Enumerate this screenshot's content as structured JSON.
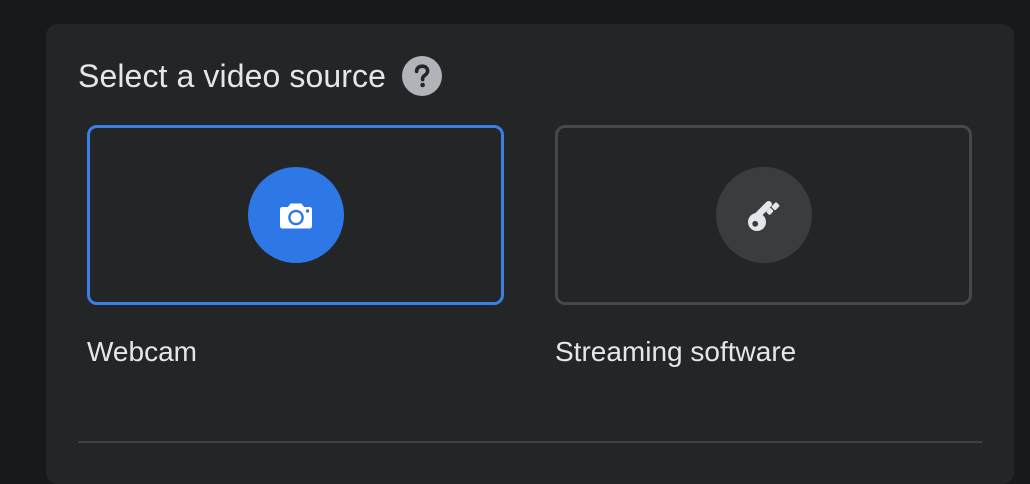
{
  "panel": {
    "title": "Select a video source",
    "help_icon": "question-mark-icon"
  },
  "options": [
    {
      "label": "Webcam",
      "icon": "camera-icon",
      "selected": true,
      "accent_color": "#2d77e6",
      "border_color": "#3a7ee8"
    },
    {
      "label": "Streaming software",
      "icon": "key-icon",
      "selected": false,
      "accent_color": "#3b3c3d",
      "border_color": "#474849"
    }
  ],
  "colors": {
    "page_background": "#18191a",
    "panel_background": "#242526",
    "text_primary": "#e4e6eb"
  }
}
